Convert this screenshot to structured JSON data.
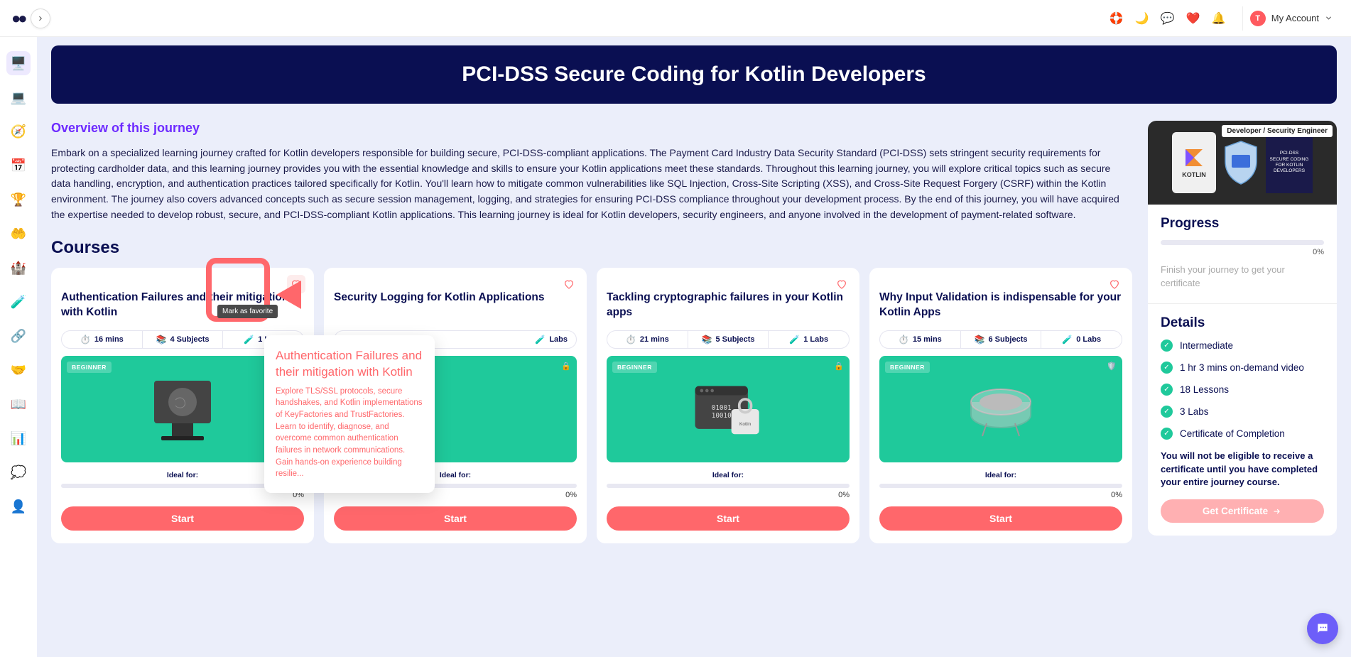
{
  "header": {
    "account_label": "My Account",
    "avatar_letter": "T"
  },
  "banner": {
    "title": "PCI-DSS Secure Coding for Kotlin Developers"
  },
  "overview": {
    "heading": "Overview of this journey",
    "text": "Embark on a specialized learning journey crafted for Kotlin developers responsible for building secure, PCI-DSS-compliant applications. The Payment Card Industry Data Security Standard (PCI-DSS) sets stringent security requirements for protecting cardholder data, and this learning journey provides you with the essential knowledge and skills to ensure your Kotlin applications meet these standards. Throughout this learning journey, you will explore critical topics such as secure data handling, encryption, and authentication practices tailored specifically for Kotlin. You'll learn how to mitigate common vulnerabilities like SQL Injection, Cross-Site Scripting (XSS), and Cross-Site Request Forgery (CSRF) within the Kotlin environment. The journey also covers advanced concepts such as secure session management, logging, and strategies for ensuring PCI-DSS compliance throughout your development process. By the end of this journey, you will have acquired the expertise needed to develop robust, secure, and PCI-DSS-compliant Kotlin applications. This learning journey is ideal for Kotlin developers, security engineers, and anyone involved in the development of payment-related software."
  },
  "courses_heading": "Courses",
  "tooltip_text": "Mark as favorite",
  "hover_popup": {
    "title": "Authentication Failures and their mitigation with Kotlin",
    "body": "Explore TLS/SSL protocols, secure handshakes, and Kotlin implementations of KeyFactories and TrustFactories. Learn to identify, diagnose, and overcome common authentication failures in network communications. Gain hands-on experience building resilie..."
  },
  "courses": [
    {
      "title": "Authentication Failures and their mitigation with Kotlin",
      "time": "16 mins",
      "subjects": "4 Subjects",
      "labs": "1 Labs",
      "level": "BEGINNER",
      "ideal": "Ideal for:",
      "progress": "0%",
      "cta": "Start"
    },
    {
      "title": "Security Logging for Kotlin Applications",
      "time": "",
      "subjects": "",
      "labs": "Labs",
      "level": "",
      "ideal": "Ideal for:",
      "progress": "0%",
      "cta": "Start"
    },
    {
      "title": "Tackling cryptographic failures in your Kotlin apps",
      "time": "21 mins",
      "subjects": "5 Subjects",
      "labs": "1 Labs",
      "level": "BEGINNER",
      "ideal": "Ideal for:",
      "progress": "0%",
      "cta": "Start"
    },
    {
      "title": "Why Input Validation is indispensable for your Kotlin Apps",
      "time": "15 mins",
      "subjects": "6 Subjects",
      "labs": "0 Labs",
      "level": "BEGINNER",
      "ideal": "Ideal for:",
      "progress": "0%",
      "cta": "Start"
    }
  ],
  "panel": {
    "role": "Developer / Security Engineer",
    "kotlin_label": "KOTLIN",
    "pci_line1": "PCI-DSS",
    "pci_line2": "SECURE CODING",
    "pci_line3": "FOR KOTLIN DEVELOPERS",
    "progress_h": "Progress",
    "progress_pct": "0%",
    "progress_note": "Finish your journey to get your certificate",
    "details_h": "Details",
    "details": [
      "Intermediate",
      "1 hr 3 mins on-demand video",
      "18 Lessons",
      "3 Labs",
      "Certificate of Completion"
    ],
    "eligible_note": "You will not be eligible to receive a certificate until you have completed your entire journey course.",
    "cert_btn": "Get Certificate"
  }
}
